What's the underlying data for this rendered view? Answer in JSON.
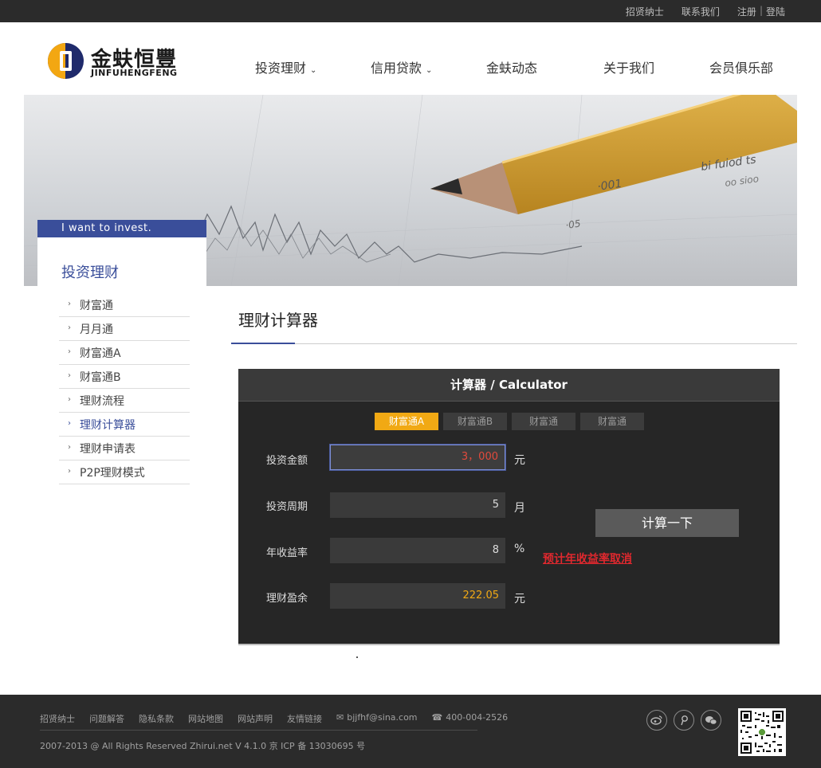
{
  "topbar": {
    "links": [
      "招贤纳士",
      "联系我们",
      "注册",
      "登陆"
    ],
    "separator": "|"
  },
  "logo": {
    "name_cn": "金蚨恒豐",
    "name_en": "JINFUHENGFENG"
  },
  "nav": {
    "items": [
      {
        "label": "投资理财",
        "dropdown": true
      },
      {
        "label": "信用贷款",
        "dropdown": true
      },
      {
        "label": "金蚨动态",
        "dropdown": false
      },
      {
        "label": "关于我们",
        "dropdown": false
      },
      {
        "label": "会员俱乐部",
        "dropdown": false
      }
    ]
  },
  "banner": {
    "numbers": [
      "·001",
      "·05",
      "bi fuiod ts",
      "oo sioo"
    ]
  },
  "sidebar": {
    "tagline": "I want to invest.",
    "title": "投资理财",
    "items": [
      {
        "label": "财富通",
        "active": false
      },
      {
        "label": "月月通",
        "active": false
      },
      {
        "label": "财富通A",
        "active": false
      },
      {
        "label": "财富通B",
        "active": false
      },
      {
        "label": "理财流程",
        "active": false
      },
      {
        "label": "理财计算器",
        "active": true
      },
      {
        "label": "理财申请表",
        "active": false
      },
      {
        "label": "P2P理财模式",
        "active": false
      }
    ]
  },
  "main": {
    "title": "理财计算器",
    "calculator": {
      "header": "计算器 / Calculator",
      "tabs": [
        {
          "label": "财富通A",
          "active": true
        },
        {
          "label": "财富通B",
          "active": false
        },
        {
          "label": "财富通",
          "active": false
        },
        {
          "label": "财富通",
          "active": false
        }
      ],
      "fields": {
        "amount": {
          "label": "投资金额",
          "value": "3，000",
          "unit": "元"
        },
        "period": {
          "label": "投资周期",
          "value": "5",
          "unit": "月"
        },
        "rate": {
          "label": "年收益率",
          "value": "8",
          "unit": "%"
        },
        "profit": {
          "label": "理财盈余",
          "value": "222.05",
          "unit": "元"
        }
      },
      "calc_button": "计算一下",
      "cancel_link": "预计年收益率取消"
    }
  },
  "footer": {
    "links": [
      "招贤纳士",
      "问题解答",
      "隐私条款",
      "网站地图",
      "网站声明",
      "友情链接"
    ],
    "email": "bjjfhf@sina.com",
    "phone": "400-004-2526",
    "copyright": "2007-2013 @ All Rights Reserved Zhirui.net V 4.1.0 京 ICP 备 13030695 号",
    "social_icons": [
      "weibo-icon",
      "tencent-weibo-icon",
      "wechat-icon"
    ]
  },
  "colors": {
    "brand_blue": "#3a4e9a",
    "accent_orange": "#f1a914",
    "alert_red": "#e0282e",
    "dark_bar": "#2b2b2b"
  }
}
